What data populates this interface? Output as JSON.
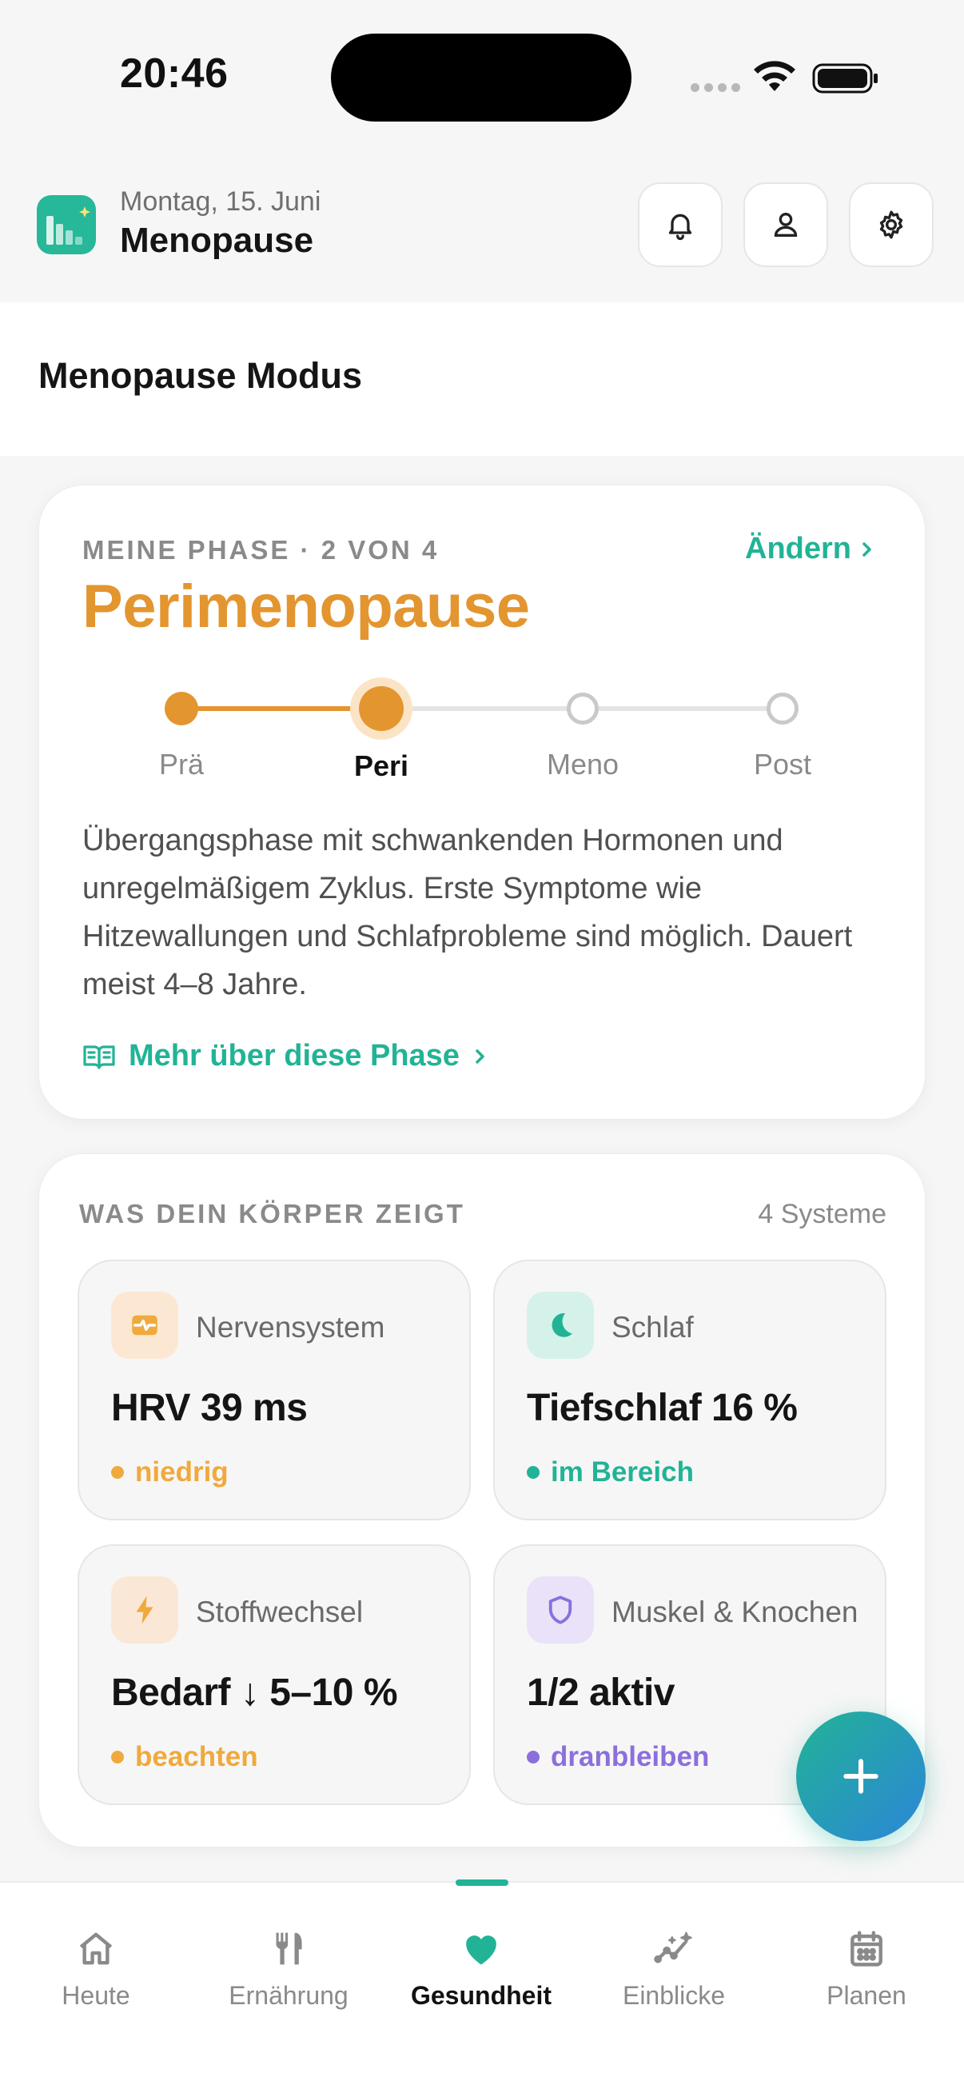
{
  "status_bar": {
    "time": "20:46"
  },
  "header": {
    "date": "Montag, 15. Juni",
    "title": "Menopause",
    "icons": [
      "bell-icon",
      "user-icon",
      "gear-icon"
    ]
  },
  "mode": {
    "title": "Menopause Modus"
  },
  "phase_card": {
    "kicker": "MEINE PHASE · 2 VON 4",
    "change_label": "Ändern",
    "phase_name": "Perimenopause",
    "steps": [
      {
        "label": "Prä"
      },
      {
        "label": "Peri"
      },
      {
        "label": "Meno"
      },
      {
        "label": "Post"
      }
    ],
    "current_step": 2,
    "description": "Übergangsphase mit schwankenden Hormonen und unregelmäßigem Zyklus. Erste Symptome wie Hitzewallungen und Schlafprobleme sind möglich. Dauert meist 4–8 Jahre.",
    "more_label": "Mehr über diese Phase"
  },
  "body_card": {
    "kicker": "WAS DEIN KÖRPER ZEIGT",
    "count": "4 Systeme",
    "systems": [
      {
        "name": "Nervensystem",
        "value": "HRV 39 ms",
        "status": "niedrig",
        "icon": "pulse-icon",
        "status_color": "#f0a93c"
      },
      {
        "name": "Schlaf",
        "value": "Tiefschlaf 16 %",
        "status": "im Bereich",
        "icon": "moon-icon",
        "status_color": "#22b396"
      },
      {
        "name": "Stoffwechsel",
        "value": "Bedarf ↓ 5–10 %",
        "status": "beachten",
        "icon": "bolt-icon",
        "status_color": "#f0a93c"
      },
      {
        "name": "Muskel & Knochen",
        "value": "1/2 aktiv",
        "status": "dranbleiben",
        "icon": "shield-icon",
        "status_color": "#8b6fdc"
      }
    ]
  },
  "tabbar": {
    "tabs": [
      {
        "label": "Heute",
        "icon": "home-icon"
      },
      {
        "label": "Ernährung",
        "icon": "cutlery-icon"
      },
      {
        "label": "Gesundheit",
        "icon": "heart-icon"
      },
      {
        "label": "Einblicke",
        "icon": "sparkle-chart-icon"
      },
      {
        "label": "Planen",
        "icon": "calendar-icon"
      }
    ],
    "active_tab": "Gesundheit"
  },
  "colors": {
    "accent": "#22b396",
    "phase_orange": "#e3952f",
    "amber": "#f0a93c",
    "purple": "#8b6fdc"
  }
}
